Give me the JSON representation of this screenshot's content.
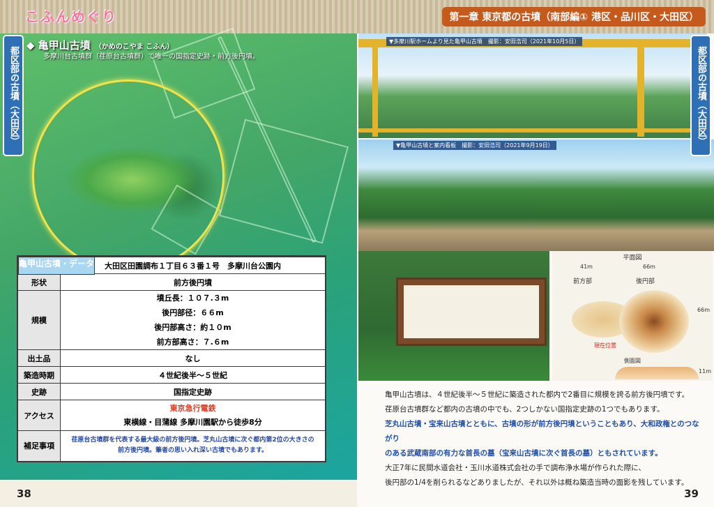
{
  "left": {
    "logo": "こふんめぐり",
    "side_tab": "都区部の古墳（大田区）",
    "title": "◆ 亀甲山古墳",
    "title_kana": "（かめのこやま こふん）",
    "subtitle": "多摩川台古墳群（荏原台古墳群）で唯一の国指定史跡・前方後円墳。",
    "table": {
      "caption": "亀甲山古墳・データ",
      "rows": [
        {
          "key": "所在地",
          "value": "大田区田園調布１丁目６３番１号　多摩川台公園内"
        },
        {
          "key": "形状",
          "value": "前方後円墳"
        },
        {
          "key": "規模",
          "lines": [
            "墳丘長：１０７.３m",
            "後円部径：６６m",
            "後円部高さ：約１０m",
            "前方部高さ：７.６m"
          ]
        },
        {
          "key": "出土品",
          "value": "なし"
        },
        {
          "key": "築造時期",
          "value": "４世紀後半～５世紀"
        },
        {
          "key": "史跡",
          "value": "国指定史跡"
        },
        {
          "key": "アクセス",
          "access_red": "東京急行電鉄",
          "access": "東横線・目蒲線 多摩川園駅から徒歩8分"
        },
        {
          "key": "補足事項",
          "note": "荏原台古墳群を代表する最大級の前方後円墳。芝丸山古墳に次ぐ都内第2位の大きさの前方後円墳。筆者の思い入れ深い古墳でもあります。"
        }
      ]
    },
    "page_number": "38"
  },
  "right": {
    "chapter": "第一章 東京都の古墳（南部編① 港区・品川区・大田区）",
    "side_tab": "都区部の古墳（大田区）",
    "caption1": "▼多摩川駅ホームより見た亀甲山古墳　撮影：安田浩司（2021年10月5日）",
    "caption2": "▼亀甲山古墳と案内看板　撮影：安田浩司（2021年9月19日）",
    "plan_title": "平面図",
    "plan_labels": {
      "d1": "41m",
      "d2": "66m",
      "front": "前方部",
      "rear": "後円部",
      "right": "66m",
      "current": "現在位置",
      "side": "側面図",
      "height": "11m"
    },
    "description": [
      {
        "text": "亀甲山古墳は、４世紀後半～５世紀に築造された都内で2番目に規模を誇る前方後円墳です。",
        "hl": false
      },
      {
        "text": "荏原台古墳群など都内の古墳の中でも、2つしかない国指定史跡の1つでもあります。",
        "hl": false
      },
      {
        "text": "芝丸山古墳・宝来山古墳とともに、古墳の形が前方後円墳ということもあり、大和政権とのつながり",
        "hl": true
      },
      {
        "text": "のある武蔵南部の有力な首長の墓（宝来山古墳に次ぐ首長の墓）ともされています。",
        "hl": true
      },
      {
        "text": "大正7年に民間水道会社・玉川水道株式会社の手で調布浄水場が作られた際に、",
        "hl": false
      },
      {
        "text": "後円部の1/4を削られるなどありましたが、それ以外は概ね築造当時の面影を残しています。",
        "hl": false
      }
    ],
    "page_number": "39"
  }
}
